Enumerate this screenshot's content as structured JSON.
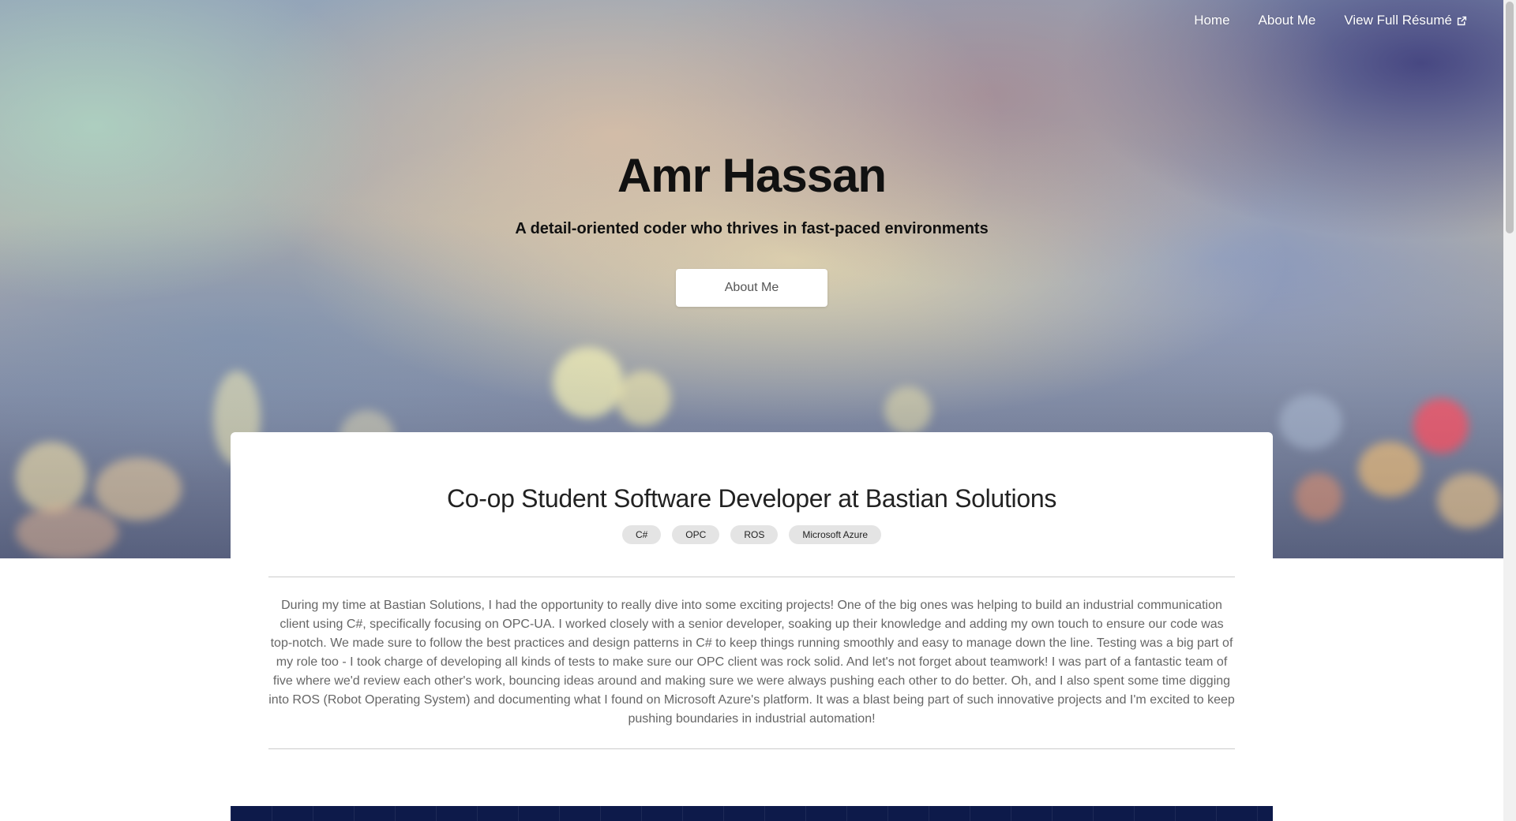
{
  "nav": {
    "home": "Home",
    "about": "About Me",
    "resume": "View Full Résumé"
  },
  "hero": {
    "title": "Amr Hassan",
    "subtitle": "A detail-oriented coder who thrives in fast-paced environments",
    "button": "About Me"
  },
  "experience": {
    "title": "Co-op Student Software Developer at Bastian Solutions",
    "tags": [
      "C#",
      "OPC",
      "ROS",
      "Microsoft Azure"
    ],
    "description": "During my time at Bastian Solutions, I had the opportunity to really dive into some exciting projects! One of the big ones was helping to build an industrial communication client using C#, specifically focusing on OPC-UA. I worked closely with a senior developer, soaking up their knowledge and adding my own touch to ensure our code was top-notch. We made sure to follow the best practices and design patterns in C# to keep things running smoothly and easy to manage down the line. Testing was a big part of my role too - I took charge of developing all kinds of tests to make sure our OPC client was rock solid. And let's not forget about teamwork! I was part of a fantastic team of five where we'd review each other's work, bouncing ideas around and making sure we were always pushing each other to do better. Oh, and I also spent some time digging into ROS (Robot Operating System) and documenting what I found on Microsoft Azure's platform. It was a blast being part of such innovative projects and I'm excited to keep pushing boundaries in industrial automation!"
  },
  "icons": {
    "external_link": "external-link-icon"
  },
  "colors": {
    "hero_text": "#111111",
    "card_bg": "#ffffff",
    "tag_bg": "#e4e4e4",
    "body_text": "#666666",
    "next_section_bg": "#0d1a4a"
  }
}
